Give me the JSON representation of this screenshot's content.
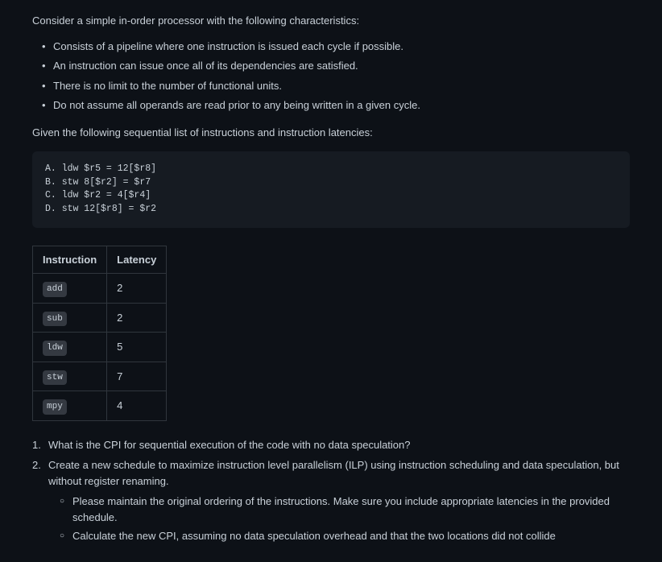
{
  "intro": "Consider a simple in-order processor with the following characteristics:",
  "characteristics": [
    "Consists of a pipeline where one instruction is issued each cycle if possible.",
    "An instruction can issue once all of its dependencies are satisfied.",
    "There is no limit to the number of functional units.",
    "Do not assume all operands are read prior to any being written in a given cycle."
  ],
  "given": "Given the following sequential list of instructions and instruction latencies:",
  "code": {
    "lineA": "A. ldw $r5 = 12[$r8]",
    "lineB": "B. stw 8[$r2] = $r7",
    "lineC": "C. ldw $r2 = 4[$r4]",
    "lineD": "D. stw 12[$r8] = $r2"
  },
  "table": {
    "headers": {
      "col1": "Instruction",
      "col2": "Latency"
    },
    "rows": [
      {
        "instr": "add",
        "latency": "2"
      },
      {
        "instr": "sub",
        "latency": "2"
      },
      {
        "instr": "ldw",
        "latency": "5"
      },
      {
        "instr": "stw",
        "latency": "7"
      },
      {
        "instr": "mpy",
        "latency": "4"
      }
    ]
  },
  "questions": {
    "q1": "What is the CPI for sequential execution of the code with no data speculation?",
    "q2": "Create a new schedule to maximize instruction level parallelism (ILP) using instruction scheduling and data speculation, but without register renaming.",
    "q2sub": [
      "Please maintain the original ordering of the instructions. Make sure you include appropriate latencies in the provided schedule.",
      "Calculate the new CPI, assuming no data speculation overhead and that the two locations did not collide"
    ]
  }
}
